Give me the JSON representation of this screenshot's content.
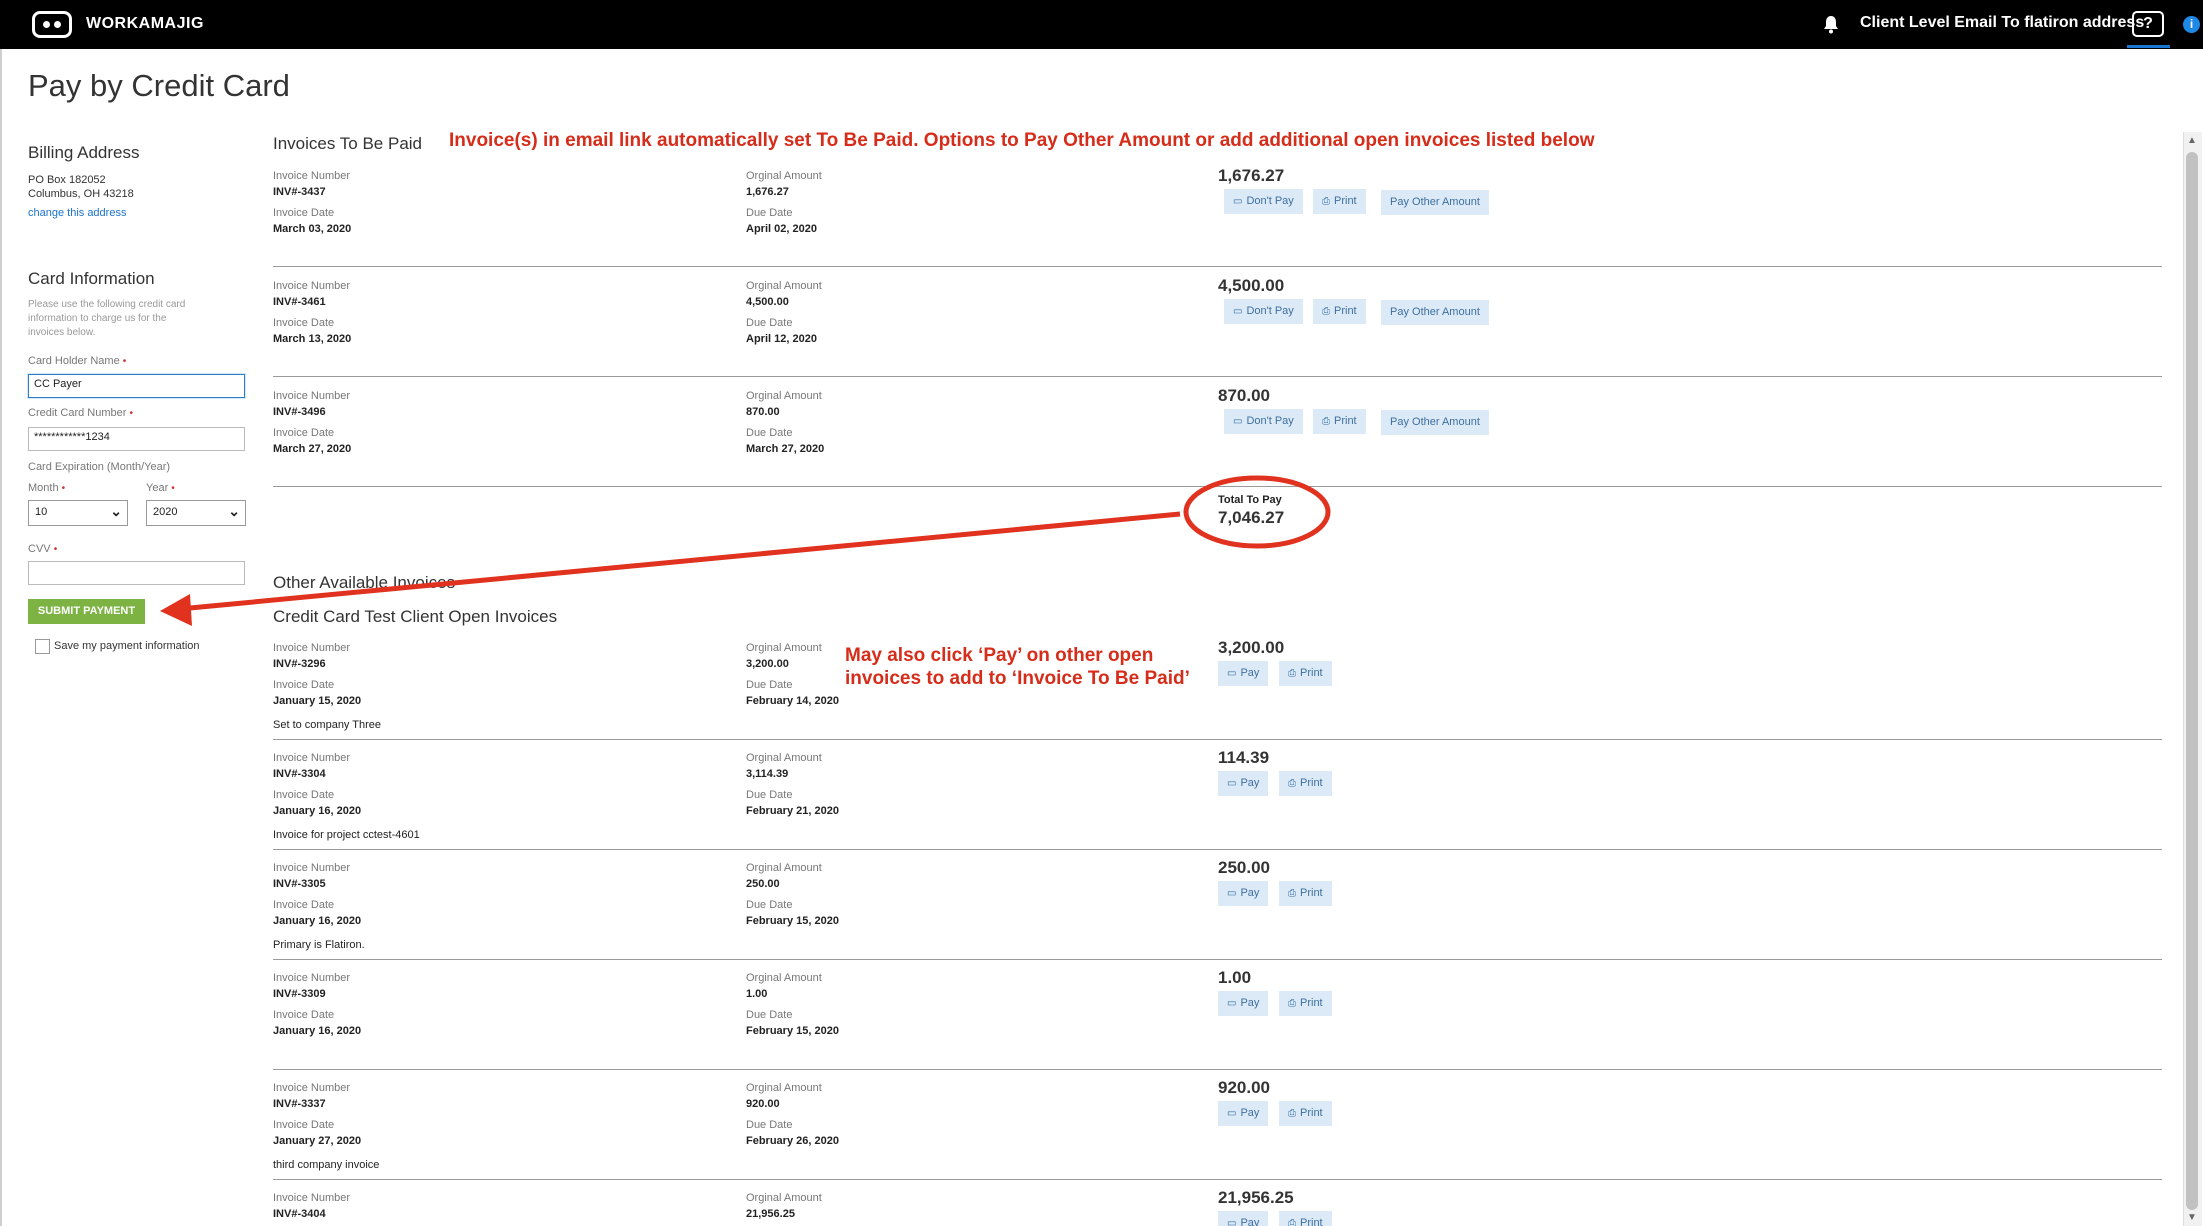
{
  "app": {
    "name": "WORKAMAJIG",
    "user_label": "Client Level Email To flatiron address",
    "help": "?",
    "info": "i"
  },
  "page": {
    "title": "Pay by Credit Card"
  },
  "billing": {
    "title": "Billing Address",
    "line1": "PO Box 182052",
    "line2": "Columbus, OH  43218",
    "change_link": "change this address"
  },
  "card": {
    "title": "Card Information",
    "help_text": "Please use the following credit card information to charge us for the invoices below.",
    "holder_label": "Card Holder Name",
    "holder_value": "CC Payer",
    "number_label": "Credit Card Number",
    "number_value": "************1234",
    "expiration_label": "Card Expiration (Month/Year)",
    "month_label": "Month",
    "month_value": "10",
    "year_label": "Year",
    "year_value": "2020",
    "cvv_label": "CVV",
    "cvv_value": "",
    "required_mark": "•",
    "submit_label": "SUBMIT PAYMENT",
    "save_label": "Save my payment information"
  },
  "labels": {
    "invoice_number": "Invoice Number",
    "original_amount": "Orginal Amount",
    "invoice_date": "Invoice Date",
    "due_date": "Due Date",
    "dont_pay": "Don't Pay",
    "print": "Print",
    "pay_other": "Pay Other Amount",
    "pay": "Pay"
  },
  "to_be_paid": {
    "title": "Invoices To Be Paid",
    "invoices": [
      {
        "number": "INV#-3437",
        "original": "1,676.27",
        "date": "March 03, 2020",
        "due": "April 02, 2020",
        "amount": "1,676.27"
      },
      {
        "number": "INV#-3461",
        "original": "4,500.00",
        "date": "March 13, 2020",
        "due": "April 12, 2020",
        "amount": "4,500.00"
      },
      {
        "number": "INV#-3496",
        "original": "870.00",
        "date": "March 27, 2020",
        "due": "March 27, 2020",
        "amount": "870.00"
      }
    ],
    "total_label": "Total To Pay",
    "total_value": "7,046.27"
  },
  "other": {
    "title": "Other Available Invoices",
    "client_title": "Credit Card Test Client Open Invoices",
    "invoices": [
      {
        "number": "INV#-3296",
        "original": "3,200.00",
        "date": "January 15, 2020",
        "due": "February 14, 2020",
        "amount": "3,200.00",
        "note": "Set to company Three"
      },
      {
        "number": "INV#-3304",
        "original": "3,114.39",
        "date": "January 16, 2020",
        "due": "February 21, 2020",
        "amount": "114.39",
        "note": "Invoice for project cctest-4601"
      },
      {
        "number": "INV#-3305",
        "original": "250.00",
        "date": "January 16, 2020",
        "due": "February 15, 2020",
        "amount": "250.00",
        "note": "Primary is Flatiron."
      },
      {
        "number": "INV#-3309",
        "original": "1.00",
        "date": "January 16, 2020",
        "due": "February 15, 2020",
        "amount": "1.00",
        "note": ""
      },
      {
        "number": "INV#-3337",
        "original": "920.00",
        "date": "January 27, 2020",
        "due": "February 26, 2020",
        "amount": "920.00",
        "note": "third company invoice"
      },
      {
        "number": "INV#-3404",
        "original": "21,956.25",
        "amount": "21,956.25"
      }
    ]
  },
  "annotations": {
    "top": "Invoice(s) in email link automatically set To Be Paid. Options to Pay Other Amount or add additional open invoices listed below",
    "middle_line1": "May also click ‘Pay’ on other open",
    "middle_line2": "invoices to add to ‘Invoice To Be Paid’"
  },
  "colors": {
    "annotation": "#d62c1a",
    "submit": "#7cb342",
    "button": "#dceaf7",
    "topbar": "#000000"
  }
}
